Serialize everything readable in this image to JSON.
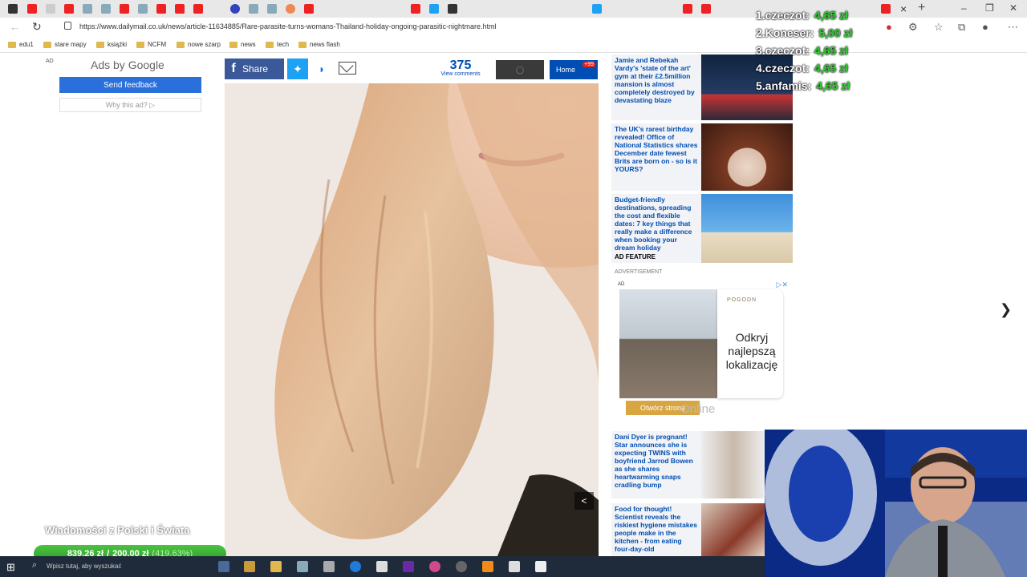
{
  "browser": {
    "url": "https://www.dailymail.co.uk/news/article-11634885/Rare-parasite-turns-womans-Thailand-holiday-ongoing-parasitic-nightmare.html",
    "close_tab": "×",
    "new_tab": "+",
    "window_controls": [
      "–",
      "❐",
      "✕"
    ]
  },
  "bookmarks": [
    "edu1",
    "stare mapy",
    "książki",
    "NCFM",
    "nowe szarp",
    "news",
    "tech",
    "news flash"
  ],
  "google_ad": {
    "ad_label": "AD",
    "ads_by": "Ads by",
    "google": "Google",
    "send_feedback": "Send feedback",
    "why_ad": "Why this ad? ▷"
  },
  "share_bar": {
    "share_label": "Share",
    "comment_count": "375",
    "comments_label": "View comments",
    "home_label": "Home",
    "home_badge": "+99"
  },
  "right_stories": [
    {
      "text": "Jamie and Rebekah Vardy's 'state of the art' gym at their £2.5million mansion is almost completely destroyed by devastating blaze"
    },
    {
      "text": "The UK's rarest birthday revealed! Office of National Statistics shares December date fewest Brits are born on - so is it YOURS?"
    },
    {
      "text": "Budget-friendly destinations, spreading the cost and flexible dates: 7 key things that really make a difference when booking your dream holiday",
      "tag": "AD FEATURE"
    },
    {
      "text": "Dani Dyer is pregnant! Star announces she is expecting TWINS with boyfriend Jarrod Bowen as she shares heartwarming snaps cradling bump"
    },
    {
      "text": "Food for thought! Scientist reveals the riskiest hygiene mistakes people make in the kitchen - from eating four-day-old"
    }
  ],
  "advert": {
    "label": "ADVERTISEMENT",
    "ad_small": "AD",
    "brand": "POGODN",
    "headline": "Odkryj najlepszą lokalizację",
    "cta": "Otwórz stronę",
    "overlay": "Online"
  },
  "stream": {
    "ranking": [
      {
        "name": "1.czeczot:",
        "amount": "4,65 zł"
      },
      {
        "name": "2.Koneser:",
        "amount": "5,00 zł"
      },
      {
        "name": "3.czeczot:",
        "amount": "4,65 zł"
      },
      {
        "name": "4.czeczot:",
        "amount": "4,65 zł"
      },
      {
        "name": "5.anfamis:",
        "amount": "4,65 zł"
      }
    ],
    "channel_title": "Wiadomości z Polski i Świata",
    "goal_current": "839,26 zł",
    "goal_sep": "/",
    "goal_target": "200,00 zł",
    "goal_pct": "(419.63%)"
  },
  "taskbar": {
    "search_placeholder": "Wpisz tutaj, aby wyszukać"
  }
}
